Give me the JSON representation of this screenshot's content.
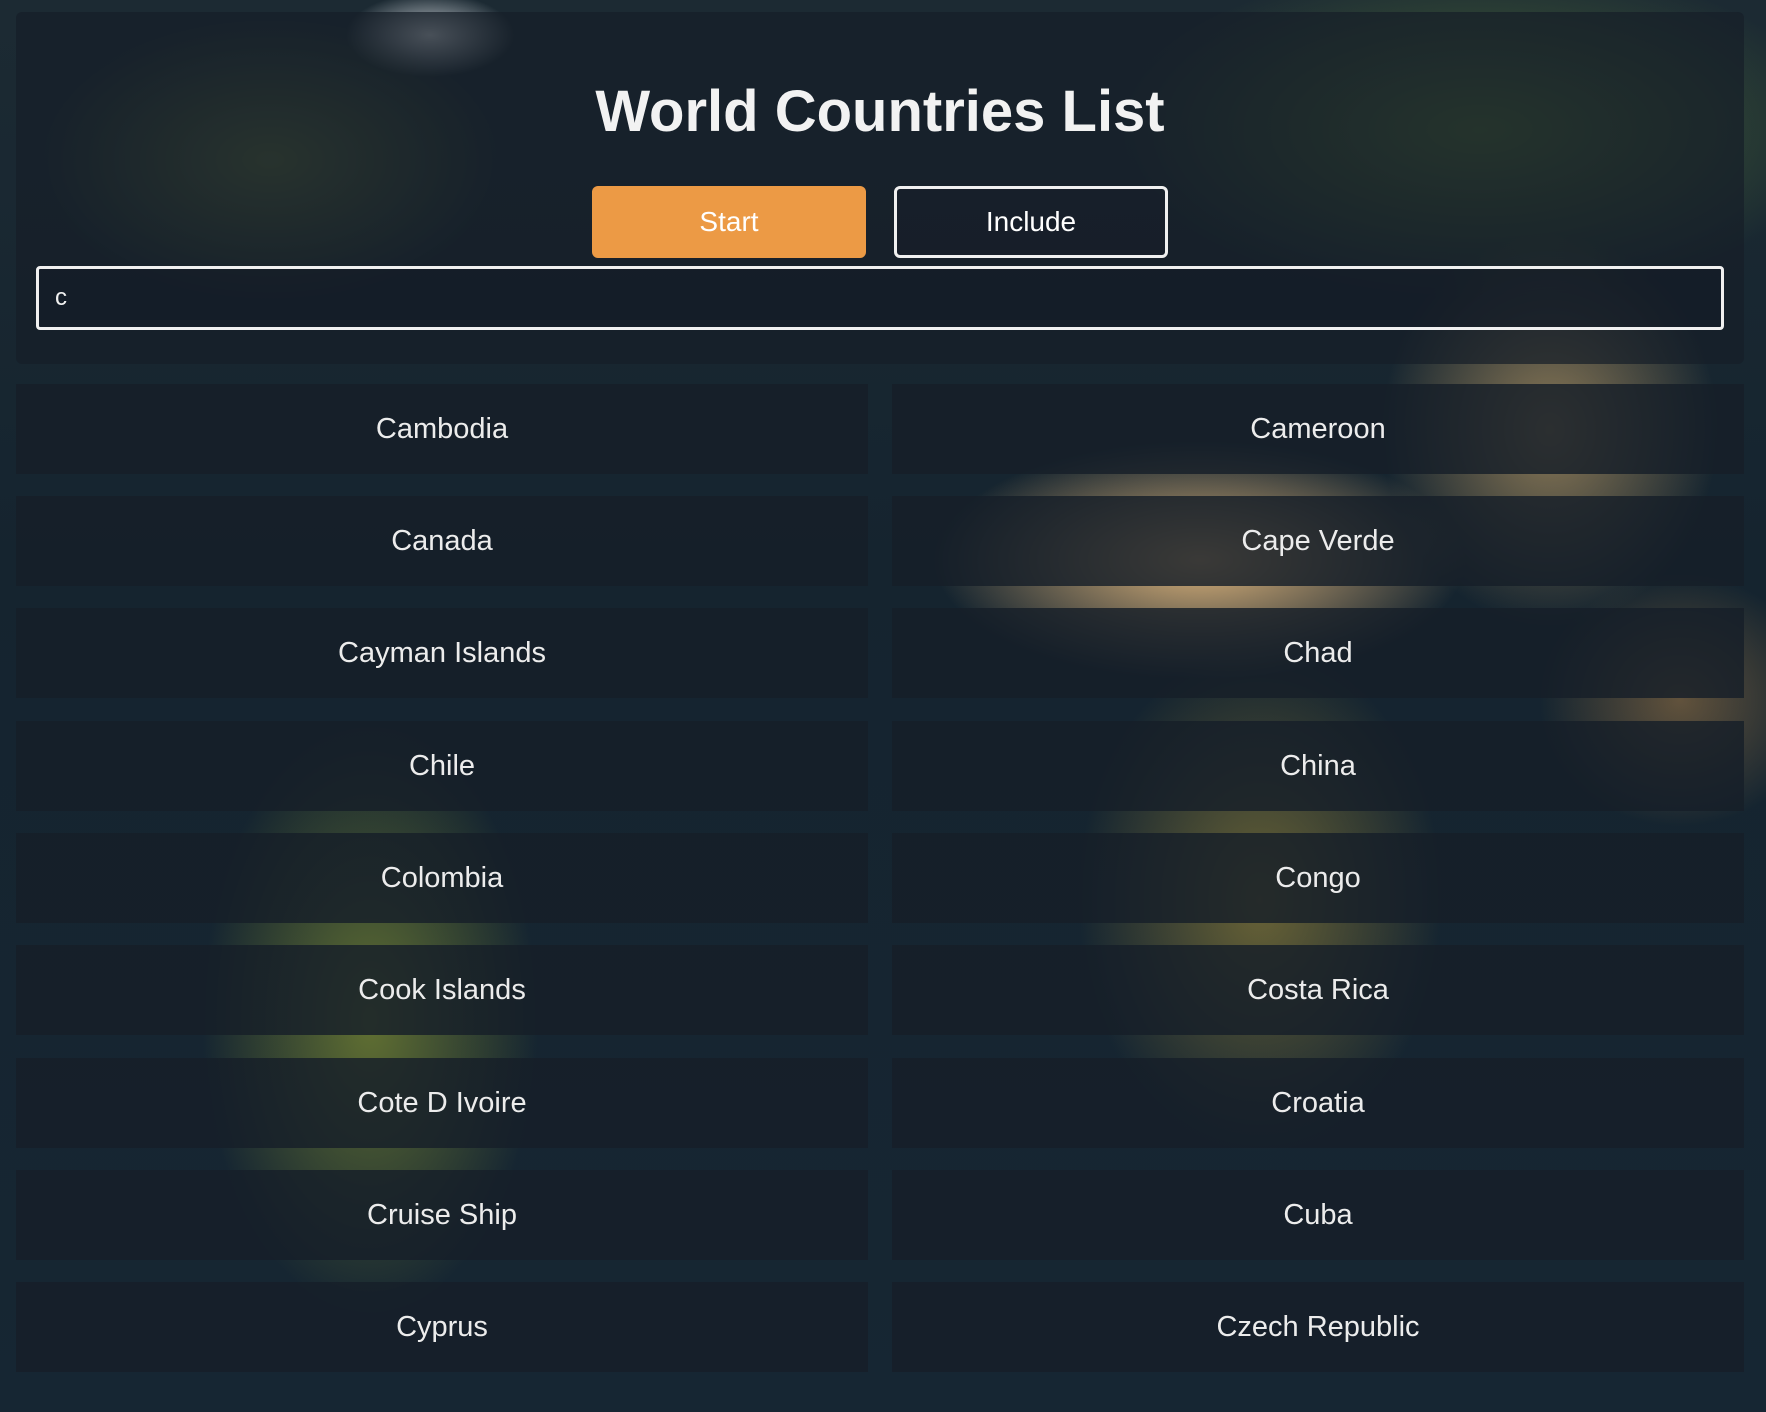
{
  "header": {
    "title": "World Countries List",
    "start_label": "Start",
    "include_label": "Include"
  },
  "search": {
    "value": "c"
  },
  "countries": [
    "Cambodia",
    "Cameroon",
    "Canada",
    "Cape Verde",
    "Cayman Islands",
    "Chad",
    "Chile",
    "China",
    "Colombia",
    "Congo",
    "Cook Islands",
    "Costa Rica",
    "Cote D Ivoire",
    "Croatia",
    "Cruise Ship",
    "Cuba",
    "Cyprus",
    "Czech Republic"
  ],
  "colors": {
    "start_button": "#ec9a45",
    "text": "#f0f0f0",
    "panel": "#161e28"
  }
}
